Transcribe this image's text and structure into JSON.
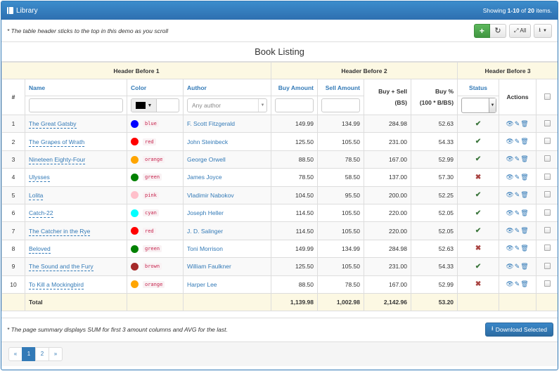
{
  "header": {
    "title": "Library",
    "summary_prefix": "Showing ",
    "summary_range": "1-10",
    "summary_mid": " of ",
    "summary_total": "20",
    "summary_suffix": " items."
  },
  "toolbar": {
    "note": "* The table header sticks to the top in this demo as you scroll",
    "add_icon": "+",
    "refresh_icon": "↻",
    "toggle_all_label": "All",
    "export_icon": "export-icon"
  },
  "table_title": "Book Listing",
  "header_before": [
    "Header Before 1",
    "Header Before 2",
    "Header Before 3"
  ],
  "columns": {
    "num": "#",
    "name": "Name",
    "color": "Color",
    "author": "Author",
    "buy": "Buy Amount",
    "sell": "Sell Amount",
    "bs_1": "Buy + Sell",
    "bs_2": "(BS)",
    "pct_1": "Buy %",
    "pct_2": "(100 * B/BS)",
    "status": "Status",
    "actions": "Actions"
  },
  "filters": {
    "name": "",
    "color_value": "#000000",
    "author_placeholder": "Any author",
    "buy": "",
    "sell": "",
    "status": ""
  },
  "rows": [
    {
      "num": "1",
      "name": "The Great Gatsby",
      "color": "blue",
      "hex": "#0000ff",
      "author": "F. Scott Fitzgerald",
      "buy": "149.99",
      "sell": "134.99",
      "bs": "284.98",
      "pct": "52.63",
      "status": "ok"
    },
    {
      "num": "2",
      "name": "The Grapes of Wrath",
      "color": "red",
      "hex": "#ff0000",
      "author": "John Steinbeck",
      "buy": "125.50",
      "sell": "105.50",
      "bs": "231.00",
      "pct": "54.33",
      "status": "ok"
    },
    {
      "num": "3",
      "name": "Nineteen Eighty-Four",
      "color": "orange",
      "hex": "#ffa500",
      "author": "George Orwell",
      "buy": "88.50",
      "sell": "78.50",
      "bs": "167.00",
      "pct": "52.99",
      "status": "ok"
    },
    {
      "num": "4",
      "name": "Ulysses",
      "color": "green",
      "hex": "#008000",
      "author": "James Joyce",
      "buy": "78.50",
      "sell": "58.50",
      "bs": "137.00",
      "pct": "57.30",
      "status": "no"
    },
    {
      "num": "5",
      "name": "Lolita",
      "color": "pink",
      "hex": "#ffc0cb",
      "author": "Vladimir Nabokov",
      "buy": "104.50",
      "sell": "95.50",
      "bs": "200.00",
      "pct": "52.25",
      "status": "ok"
    },
    {
      "num": "6",
      "name": "Catch-22",
      "color": "cyan",
      "hex": "#00ffff",
      "author": "Joseph Heller",
      "buy": "114.50",
      "sell": "105.50",
      "bs": "220.00",
      "pct": "52.05",
      "status": "ok"
    },
    {
      "num": "7",
      "name": "The Catcher in the Rye",
      "color": "red",
      "hex": "#ff0000",
      "author": "J. D. Salinger",
      "buy": "114.50",
      "sell": "105.50",
      "bs": "220.00",
      "pct": "52.05",
      "status": "ok"
    },
    {
      "num": "8",
      "name": "Beloved",
      "color": "green",
      "hex": "#008000",
      "author": "Toni Morrison",
      "buy": "149.99",
      "sell": "134.99",
      "bs": "284.98",
      "pct": "52.63",
      "status": "no"
    },
    {
      "num": "9",
      "name": "The Sound and the Fury",
      "color": "brown",
      "hex": "#a52a2a",
      "author": "William Faulkner",
      "buy": "125.50",
      "sell": "105.50",
      "bs": "231.00",
      "pct": "54.33",
      "status": "ok"
    },
    {
      "num": "10",
      "name": "To Kill a Mockingbird",
      "color": "orange",
      "hex": "#ffa500",
      "author": "Harper Lee",
      "buy": "88.50",
      "sell": "78.50",
      "bs": "167.00",
      "pct": "52.99",
      "status": "no"
    }
  ],
  "status_icons": {
    "ok": "✔",
    "no": "✖"
  },
  "totals": {
    "label": "Total",
    "buy": "1,139.98",
    "sell": "1,002.98",
    "bs": "2,142.96",
    "pct": "53.20"
  },
  "footer": {
    "note": "* The page summary displays SUM for first 3 amount columns and AVG for the last.",
    "download_label": "Download Selected"
  },
  "pagination": {
    "prev": "«",
    "pages": [
      "1",
      "2"
    ],
    "active": "1",
    "next": "»"
  }
}
